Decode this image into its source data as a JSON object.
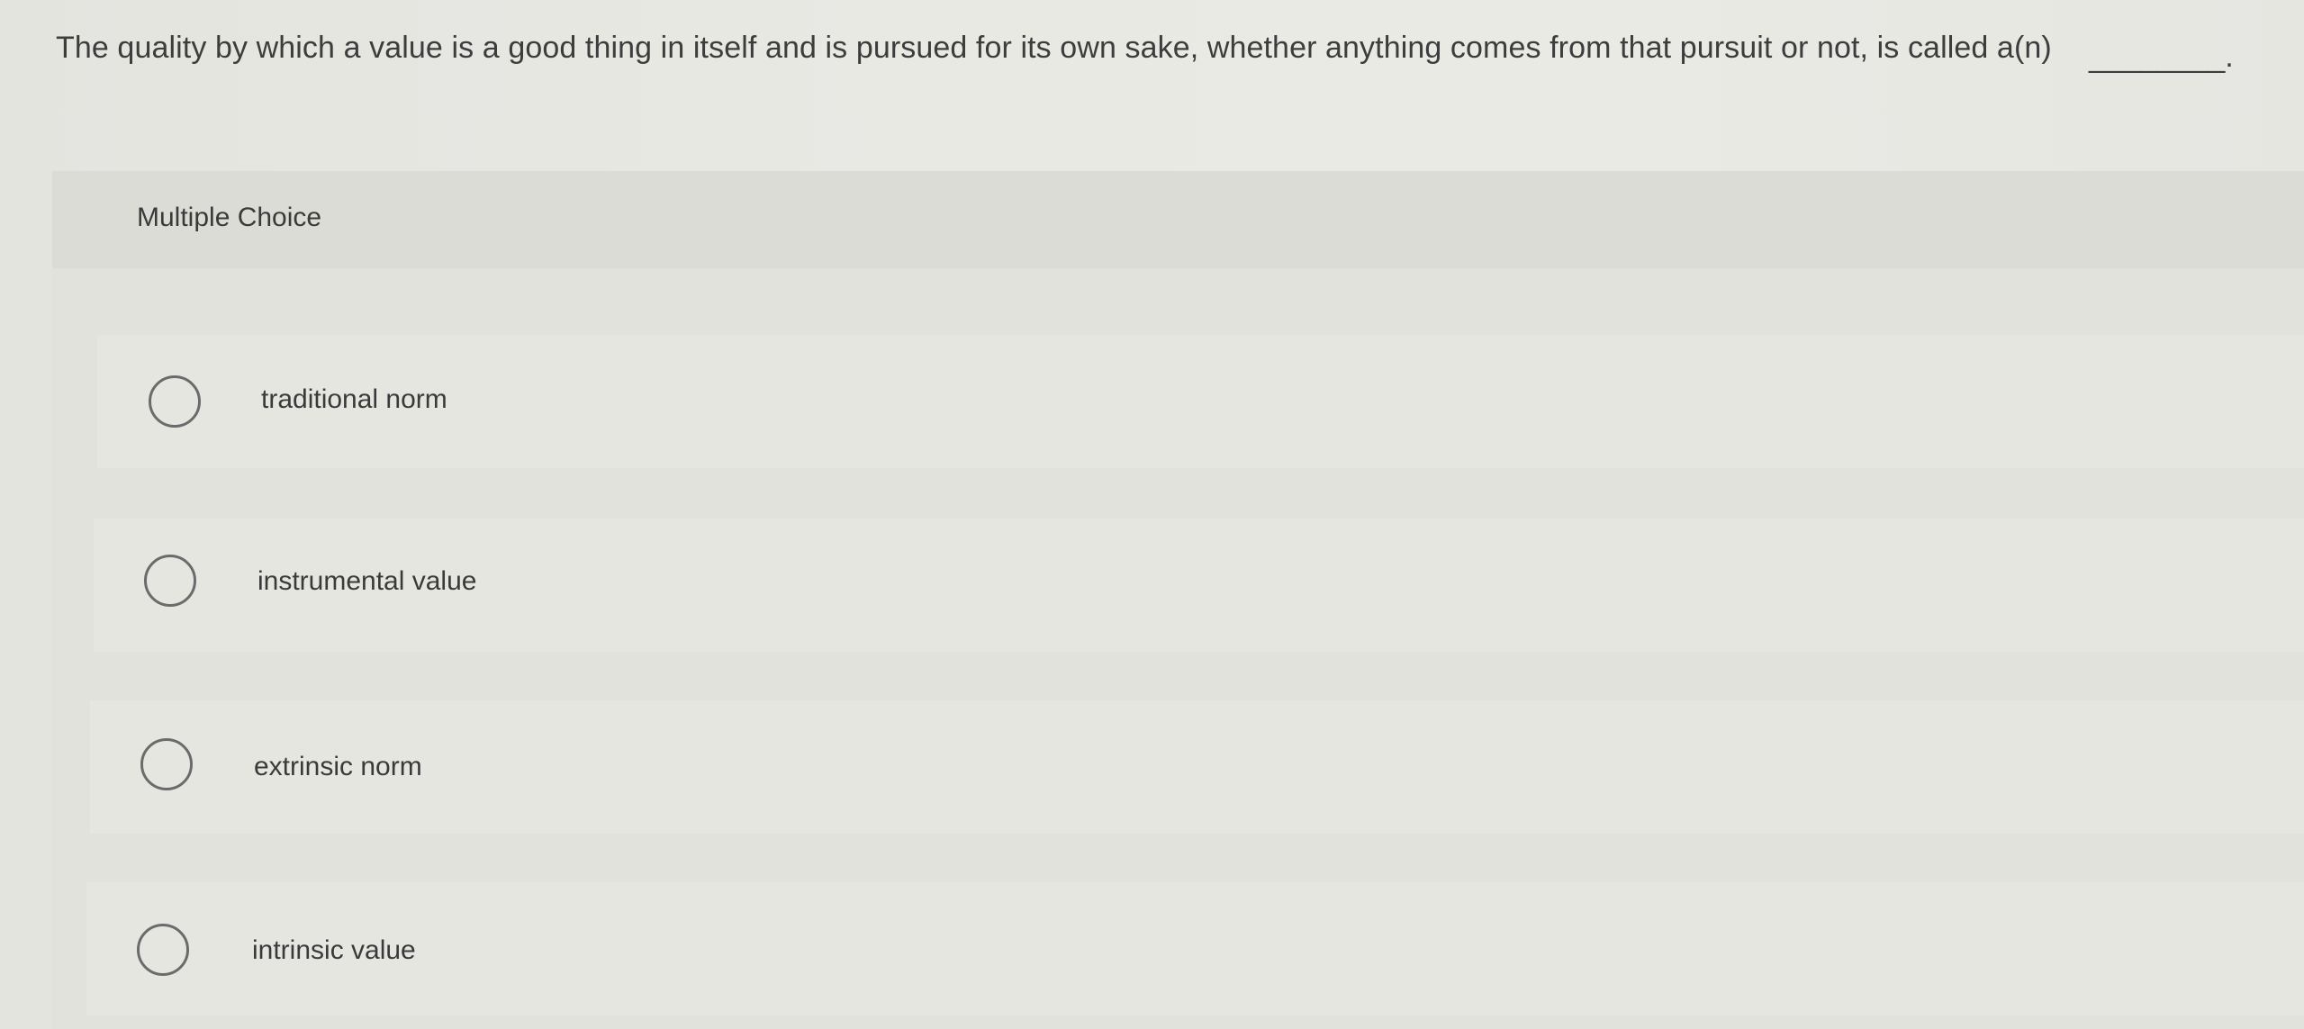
{
  "question": {
    "text": "The quality by which a value is a good thing in itself and is pursued for its own sake, whether anything comes from that pursuit or not, is called a(n)",
    "blank": "________."
  },
  "panel": {
    "title": "Multiple Choice"
  },
  "options": [
    {
      "label": "traditional norm"
    },
    {
      "label": "instrumental value"
    },
    {
      "label": "extrinsic norm"
    },
    {
      "label": "intrinsic value"
    }
  ]
}
